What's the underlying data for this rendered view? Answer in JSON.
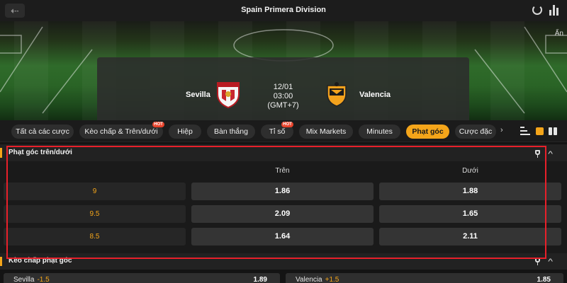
{
  "header": {
    "title": "Spain Primera Division",
    "back_icon": "arrow-left-icon",
    "back_glyph": "⇠",
    "refresh_icon": "refresh-icon",
    "stats_icon": "bar-chart-icon"
  },
  "banner": {
    "hide_label": "Ẩn",
    "home_team": "Sevilla",
    "away_team": "Valencia",
    "date": "12/01",
    "time": "03:00",
    "timezone": "(GMT+7)"
  },
  "tabs": [
    {
      "label": "Tất cả các cược",
      "active": false,
      "hot": false
    },
    {
      "label": "Kèo chấp & Trên/dưới",
      "active": false,
      "hot": true
    },
    {
      "label": "Hiệp",
      "active": false,
      "hot": false
    },
    {
      "label": "Bàn thắng",
      "active": false,
      "hot": false
    },
    {
      "label": "Tỉ số",
      "active": false,
      "hot": true
    },
    {
      "label": "Mix Markets",
      "active": false,
      "hot": false
    },
    {
      "label": "Minutes",
      "active": false,
      "hot": false
    },
    {
      "label": "Phạt góc",
      "active": true,
      "hot": false
    },
    {
      "label": "Cược đặc",
      "active": false,
      "hot": false
    }
  ],
  "hot_badge": "HOT",
  "tab_scroll_glyph": "›",
  "collapse_glyph": "^",
  "market": {
    "title": "Phạt góc trên/dưới",
    "col_over": "Trên",
    "col_under": "Dưới",
    "rows": [
      {
        "line": "9",
        "over": "1.86",
        "under": "1.88"
      },
      {
        "line": "9.5",
        "over": "2.09",
        "under": "1.65"
      },
      {
        "line": "8.5",
        "over": "1.64",
        "under": "2.11"
      }
    ]
  },
  "market2": {
    "title": "Kèo chấp phạt góc",
    "rows": [
      {
        "team": "Sevilla",
        "line": "-1.5",
        "odd": "1.89"
      },
      {
        "team": "Valencia",
        "line": "+1.5",
        "odd": "1.85"
      }
    ]
  },
  "colors": {
    "accent": "#f4a51a",
    "highlight": "#e8202a",
    "hot": "#e8432b"
  }
}
